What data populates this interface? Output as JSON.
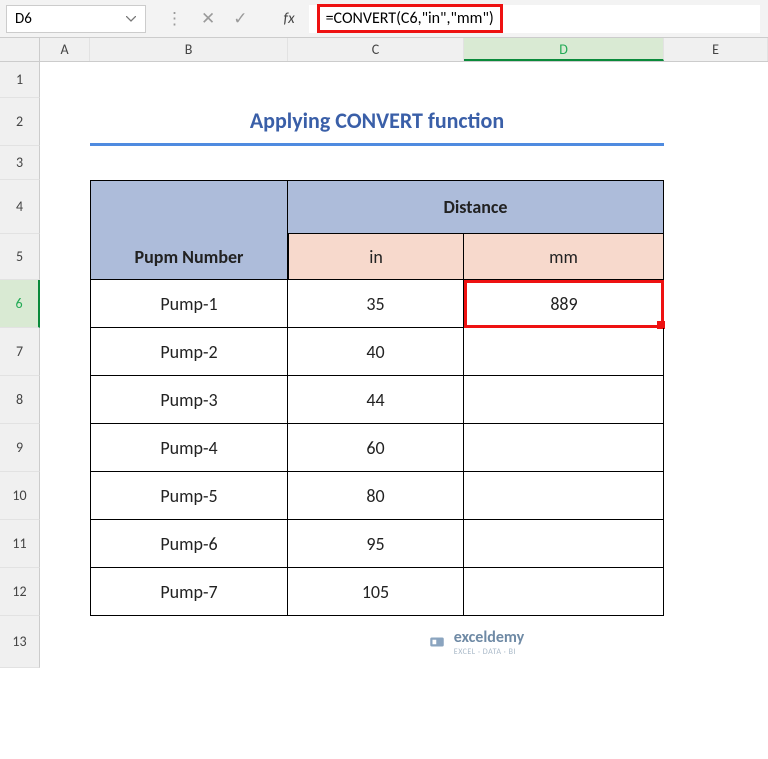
{
  "name_box": "D6",
  "fx_label": "fx",
  "formula": "=CONVERT(C6,\"in\",\"mm\")",
  "columns": [
    "A",
    "B",
    "C",
    "D",
    "E"
  ],
  "selected_col": "D",
  "selected_row": "6",
  "rows": [
    "1",
    "2",
    "3",
    "4",
    "5",
    "6",
    "7",
    "8",
    "9",
    "10",
    "11",
    "12",
    "13"
  ],
  "title": "Applying CONVERT function",
  "headers": {
    "pump": "Pupm Number",
    "distance": "Distance",
    "in": "in",
    "mm": "mm"
  },
  "data": [
    {
      "pump": "Pump-1",
      "in": "35",
      "mm": "889"
    },
    {
      "pump": "Pump-2",
      "in": "40",
      "mm": ""
    },
    {
      "pump": "Pump-3",
      "in": "44",
      "mm": ""
    },
    {
      "pump": "Pump-4",
      "in": "60",
      "mm": ""
    },
    {
      "pump": "Pump-5",
      "in": "80",
      "mm": ""
    },
    {
      "pump": "Pump-6",
      "in": "95",
      "mm": ""
    },
    {
      "pump": "Pump-7",
      "in": "105",
      "mm": ""
    }
  ],
  "watermark": {
    "brand": "exceldemy",
    "tag": "EXCEL · DATA · BI"
  }
}
